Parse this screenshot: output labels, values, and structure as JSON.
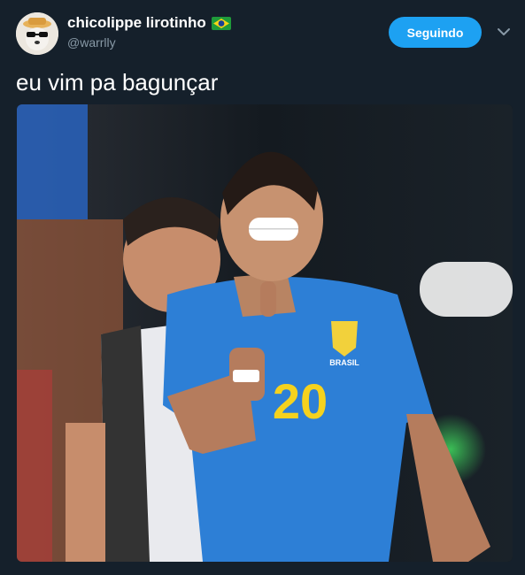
{
  "user": {
    "display_name": "chicolippe lirotinho",
    "handle": "@warrlly",
    "avatar_icon": "avatar-dog-sunglasses-icon",
    "flag_icon": "brazil-flag-icon"
  },
  "actions": {
    "follow_label": "Seguindo",
    "menu_icon": "chevron-down-icon"
  },
  "tweet": {
    "text": "eu vim pa bagunçar"
  },
  "media": {
    "jersey_number": "20",
    "jersey_text": "BRASIL"
  },
  "colors": {
    "background": "#15202b",
    "accent": "#1da1f2",
    "secondary_text": "#8899a6"
  }
}
